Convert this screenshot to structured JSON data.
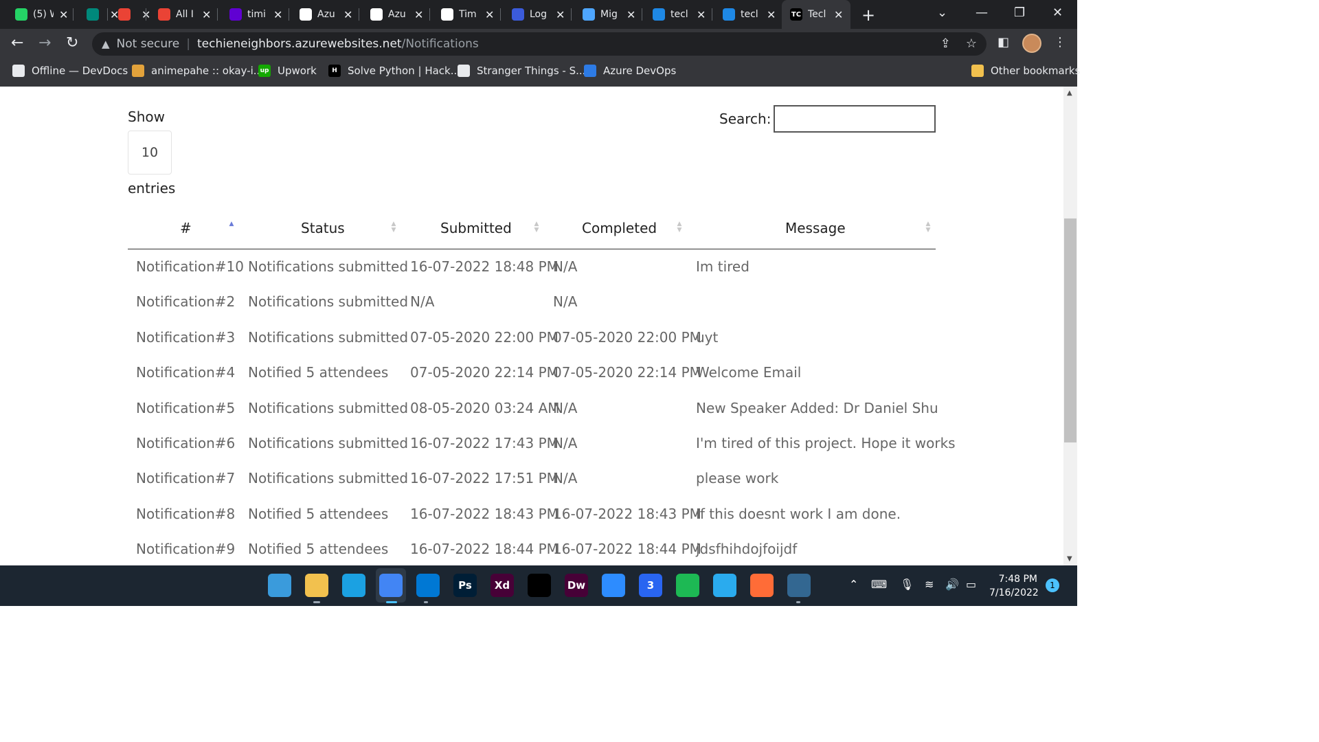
{
  "browser": {
    "tabs": [
      {
        "label": "(5) W",
        "icon": "whatsapp-icon",
        "color": "#25d366"
      },
      {
        "label": "",
        "icon": "google-meet-icon",
        "color": "#00897b"
      },
      {
        "label": "",
        "icon": "record-icon",
        "color": "#ea4335"
      },
      {
        "label": "All I",
        "icon": "gmail-icon",
        "color": "#ea4335"
      },
      {
        "label": "timi",
        "icon": "yahoo-icon",
        "color": "#6001d2"
      },
      {
        "label": "Azu",
        "icon": "github-icon",
        "color": "#ffffff"
      },
      {
        "label": "Azu",
        "icon": "github-icon",
        "color": "#ffffff"
      },
      {
        "label": "Tim",
        "icon": "github-icon",
        "color": "#ffffff"
      },
      {
        "label": "Log",
        "icon": "bluetooth-icon",
        "color": "#3b5bdb"
      },
      {
        "label": "Mig",
        "icon": "visual-studio-icon",
        "color": "#4ea6ff"
      },
      {
        "label": "tecl",
        "icon": "azure-icon",
        "color": "#1e88e5"
      },
      {
        "label": "tecl",
        "icon": "azure-icon",
        "color": "#1e88e5"
      },
      {
        "label": "Tecl",
        "icon": "techie-icon",
        "color": "#000000",
        "badge": "TC"
      }
    ],
    "url": {
      "security_text": "Not secure",
      "host": "techieneighbors.azurewebsites.net",
      "path": "/Notifications"
    },
    "bookmarks": [
      {
        "label": "Offline — DevDocs",
        "icon": "devdocs-icon",
        "color": "#e8eaed"
      },
      {
        "label": "animepahe :: okay-i...",
        "icon": "animepahe-icon",
        "color": "#e2a23b"
      },
      {
        "label": "Upwork",
        "icon": "upwork-icon",
        "color": "#14a800",
        "badge": "up"
      },
      {
        "label": "Solve Python | Hack...",
        "icon": "hackerrank-icon",
        "color": "#000000",
        "badge": "H"
      },
      {
        "label": "Stranger Things - S...",
        "icon": "netflix-icon",
        "color": "#e8eaed"
      },
      {
        "label": "Azure DevOps",
        "icon": "azure-devops-icon",
        "color": "#2d7be5"
      }
    ],
    "other_bookmarks": "Other bookmarks"
  },
  "page": {
    "show_label": "Show",
    "page_length": "10",
    "entries_label": "entries",
    "search_label": "Search:",
    "search_value": "",
    "columns": [
      "#",
      "Status",
      "Submitted",
      "Completed",
      "Message"
    ],
    "sorted_column": "#",
    "rows": [
      [
        "Notification#10",
        "Notifications submitted",
        "16-07-2022 18:48 PM",
        "N/A",
        "Im tired"
      ],
      [
        "Notification#2",
        "Notifications submitted",
        "N/A",
        "N/A",
        ""
      ],
      [
        "Notification#3",
        "Notifications submitted",
        "07-05-2020 22:00 PM",
        "07-05-2020 22:00 PM",
        "uyt"
      ],
      [
        "Notification#4",
        "Notified 5 attendees",
        "07-05-2020 22:14 PM",
        "07-05-2020 22:14 PM",
        "Welcome Email"
      ],
      [
        "Notification#5",
        "Notifications submitted",
        "08-05-2020 03:24 AM",
        "N/A",
        "New Speaker Added: Dr Daniel Shu"
      ],
      [
        "Notification#6",
        "Notifications submitted",
        "16-07-2022 17:43 PM",
        "N/A",
        "I'm tired of this project. Hope it works"
      ],
      [
        "Notification#7",
        "Notifications submitted",
        "16-07-2022 17:51 PM",
        "N/A",
        "please work"
      ],
      [
        "Notification#8",
        "Notified 5 attendees",
        "16-07-2022 18:43 PM",
        "16-07-2022 18:43 PM",
        "If this doesnt work I am done."
      ],
      [
        "Notification#9",
        "Notified 5 attendees",
        "16-07-2022 18:44 PM",
        "16-07-2022 18:44 PM",
        "jdsfhihdojfoijdf"
      ]
    ]
  },
  "taskbar": {
    "apps": [
      {
        "icon": "windows-start-icon",
        "label": "",
        "color": "#3a9bdc"
      },
      {
        "icon": "file-explorer-icon",
        "label": "",
        "color": "#f2c14e"
      },
      {
        "icon": "edge-icon",
        "label": "",
        "color": "#1ba1e2"
      },
      {
        "icon": "chrome-icon",
        "label": "",
        "color": "#4285f4"
      },
      {
        "icon": "vscode-icon",
        "label": "",
        "color": "#0078d4"
      },
      {
        "icon": "photoshop-icon",
        "label": "Ps",
        "color": "#001e36"
      },
      {
        "icon": "xd-icon",
        "label": "Xd",
        "color": "#470137"
      },
      {
        "icon": "obs-icon",
        "label": "",
        "color": "#000000"
      },
      {
        "icon": "dreamweaver-icon",
        "label": "Dw",
        "color": "#470137"
      },
      {
        "icon": "zoom-icon",
        "label": "",
        "color": "#2d8cff"
      },
      {
        "icon": "css3-icon",
        "label": "3",
        "color": "#2965f1"
      },
      {
        "icon": "spotify-icon",
        "label": "",
        "color": "#1db954"
      },
      {
        "icon": "telegram-icon",
        "label": "",
        "color": "#2aabee"
      },
      {
        "icon": "postman-icon",
        "label": "",
        "color": "#ff6c37"
      },
      {
        "icon": "pgadmin-icon",
        "label": "",
        "color": "#336791"
      }
    ],
    "time": "7:48 PM",
    "date": "7/16/2022",
    "notification_count": "1"
  }
}
